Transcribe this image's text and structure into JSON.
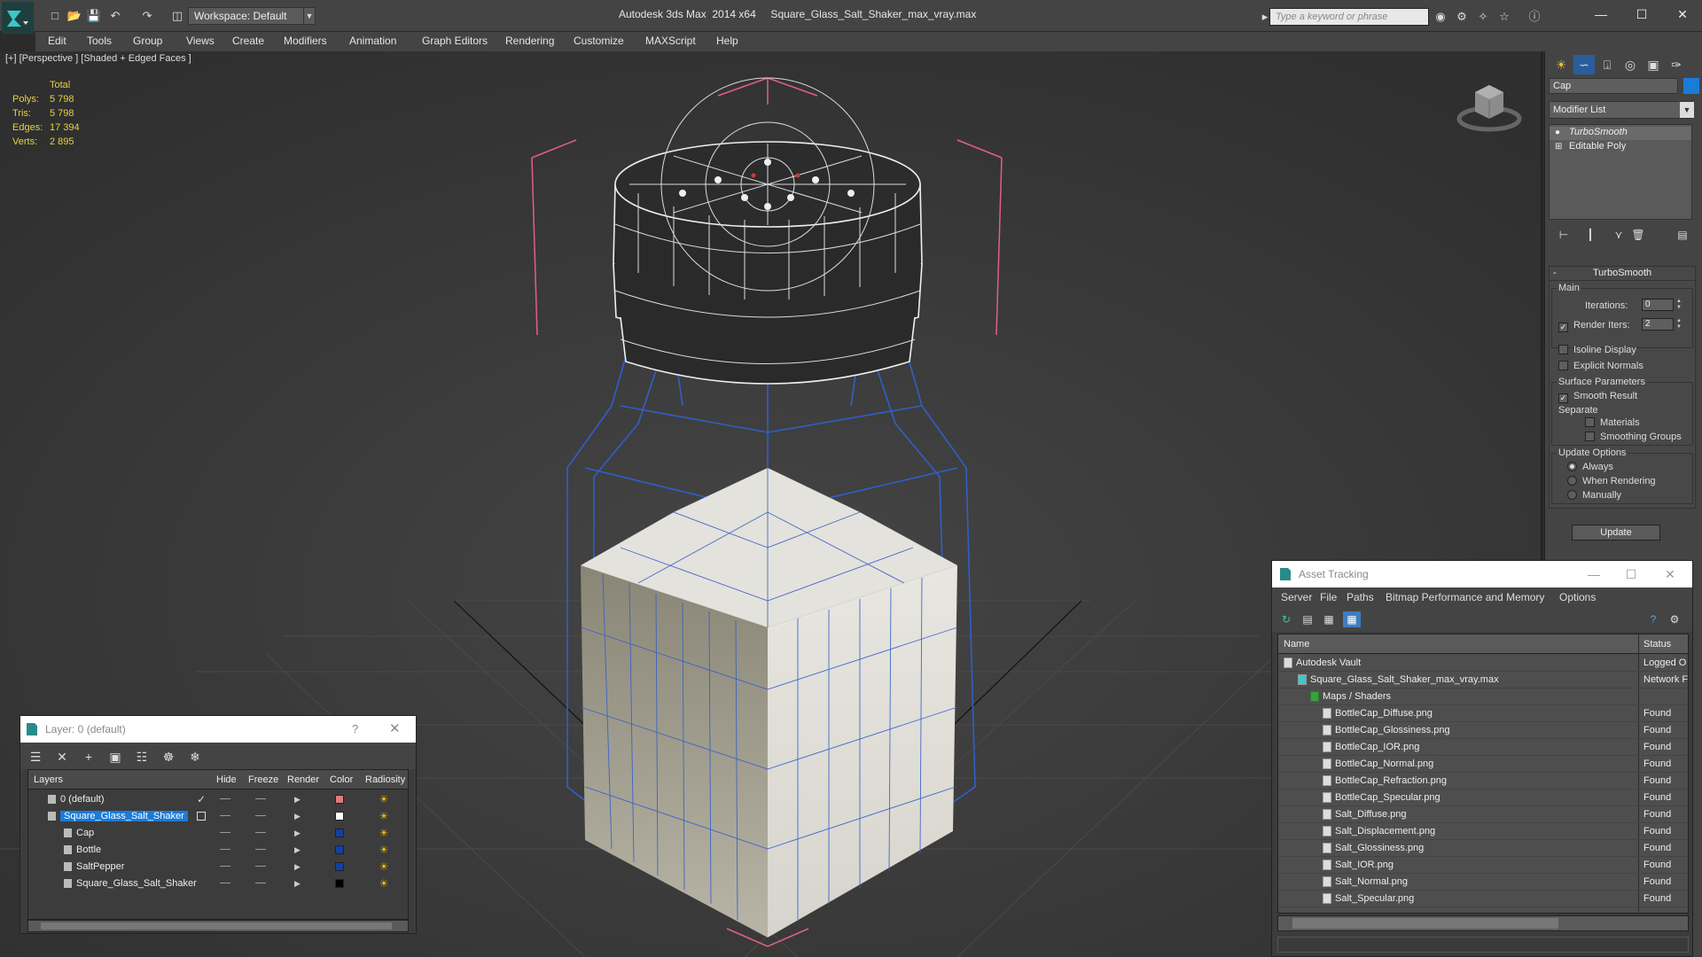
{
  "window": {
    "title": "Autodesk 3ds Max  2014 x64     Square_Glass_Salt_Shaker_max_vray.max",
    "workspace": "Workspace: Default",
    "search_placeholder": "Type a keyword or phrase"
  },
  "menu": [
    "Edit",
    "Tools",
    "Group",
    "Views",
    "Create",
    "Modifiers",
    "Animation",
    "Graph Editors",
    "Rendering",
    "Customize",
    "MAXScript",
    "Help"
  ],
  "viewport": {
    "label": "[+] [Perspective ] [Shaded + Edged Faces ]",
    "stats": {
      "total_label": "Total",
      "rows": [
        {
          "k": "Polys:",
          "v": "5 798"
        },
        {
          "k": "Tris:",
          "v": "5 798"
        },
        {
          "k": "Edges:",
          "v": "17 394"
        },
        {
          "k": "Verts:",
          "v": "2 895"
        }
      ]
    }
  },
  "command_panel": {
    "object_name": "Cap",
    "object_color": "#1a7bd8",
    "modifier_list": "Modifier List",
    "stack": [
      "TurboSmooth",
      "Editable Poly"
    ],
    "turbosmooth": {
      "title": "TurboSmooth",
      "main_label": "Main",
      "iterations_label": "Iterations:",
      "iterations": "0",
      "render_iters_label": "Render Iters:",
      "render_iters": "2",
      "isoline": "Isoline Display",
      "explicit": "Explicit Normals",
      "surface_label": "Surface Parameters",
      "smooth_result": "Smooth Result",
      "separate_label": "Separate",
      "materials": "Materials",
      "smoothing_groups": "Smoothing Groups",
      "update_label": "Update Options",
      "always": "Always",
      "when_rendering": "When Rendering",
      "manually": "Manually",
      "update_btn": "Update"
    }
  },
  "asset_tracking": {
    "title": "Asset Tracking",
    "menu": [
      "Server",
      "File",
      "Paths",
      "Bitmap Performance and Memory",
      "Options"
    ],
    "columns": [
      "Name",
      "Status"
    ],
    "rows": [
      {
        "name": "Autodesk Vault",
        "status": "Logged O",
        "level": 1
      },
      {
        "name": "Square_Glass_Salt_Shaker_max_vray.max",
        "status": "Network F",
        "level": 2
      },
      {
        "name": "Maps / Shaders",
        "status": "",
        "level": 3
      },
      {
        "name": "BottleCap_Diffuse.png",
        "status": "Found",
        "level": 4
      },
      {
        "name": "BottleCap_Glossiness.png",
        "status": "Found",
        "level": 4
      },
      {
        "name": "BottleCap_IOR.png",
        "status": "Found",
        "level": 4
      },
      {
        "name": "BottleCap_Normal.png",
        "status": "Found",
        "level": 4
      },
      {
        "name": "BottleCap_Refraction.png",
        "status": "Found",
        "level": 4
      },
      {
        "name": "BottleCap_Specular.png",
        "status": "Found",
        "level": 4
      },
      {
        "name": "Salt_Diffuse.png",
        "status": "Found",
        "level": 4
      },
      {
        "name": "Salt_Displacement.png",
        "status": "Found",
        "level": 4
      },
      {
        "name": "Salt_Glossiness.png",
        "status": "Found",
        "level": 4
      },
      {
        "name": "Salt_IOR.png",
        "status": "Found",
        "level": 4
      },
      {
        "name": "Salt_Normal.png",
        "status": "Found",
        "level": 4
      },
      {
        "name": "Salt_Specular.png",
        "status": "Found",
        "level": 4
      }
    ]
  },
  "layers": {
    "title": "Layer: 0 (default)",
    "help": "?",
    "columns": [
      "Layers",
      "Hide",
      "Freeze",
      "Render",
      "Color",
      "Radiosity"
    ],
    "rows": [
      {
        "name": "0 (default)",
        "color": "#e07a7a",
        "selected": false,
        "child": false
      },
      {
        "name": "Square_Glass_Salt_Shaker",
        "color": "#ffffff",
        "selected": true,
        "child": false
      },
      {
        "name": "Cap",
        "color": "#1540a0",
        "selected": false,
        "child": true
      },
      {
        "name": "Bottle",
        "color": "#1540a0",
        "selected": false,
        "child": true
      },
      {
        "name": "SaltPepper",
        "color": "#1540a0",
        "selected": false,
        "child": true
      },
      {
        "name": "Square_Glass_Salt_Shaker",
        "color": "#000000",
        "selected": false,
        "child": true
      }
    ]
  }
}
